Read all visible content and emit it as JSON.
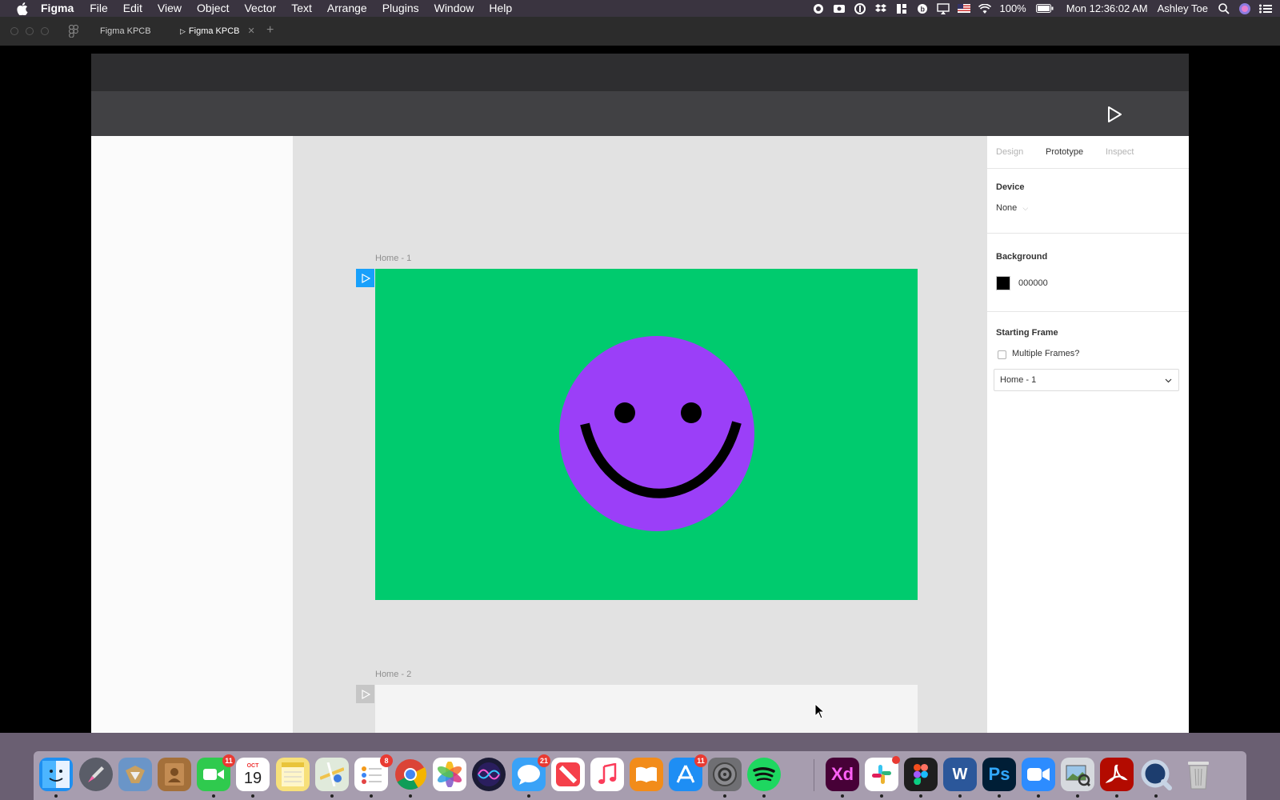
{
  "menubar": {
    "app_name": "Figma",
    "items": [
      "File",
      "Edit",
      "View",
      "Object",
      "Vector",
      "Text",
      "Arrange",
      "Plugins",
      "Window",
      "Help"
    ],
    "battery": "100%",
    "datetime": "Mon 12:36:02 AM",
    "user": "Ashley Toe"
  },
  "tabs": {
    "home_tab": "Figma KPCB",
    "active_tab": "Figma KPCB"
  },
  "canvas": {
    "frame1_label": "Home - 1",
    "frame2_label": "Home - 2",
    "frame1_color": "#00cb6e",
    "smiley_color": "#9b3ff8"
  },
  "right_panel": {
    "tabs": [
      "Design",
      "Prototype",
      "Inspect"
    ],
    "active_tab": "Prototype",
    "device_title": "Device",
    "device_value": "None",
    "background_title": "Background",
    "background_value": "000000",
    "starting_frame_title": "Starting Frame",
    "multiple_frames_label": "Multiple Frames?",
    "starting_frame_value": "Home - 1"
  },
  "dock": {
    "badges": {
      "facetime": "11",
      "calendar_day": "19",
      "calendar_month": "OCT",
      "reminders": "8",
      "messages": "21",
      "app_store": "11"
    },
    "xd_label": "Xd",
    "word_label": "W",
    "ps_label": "Ps"
  }
}
